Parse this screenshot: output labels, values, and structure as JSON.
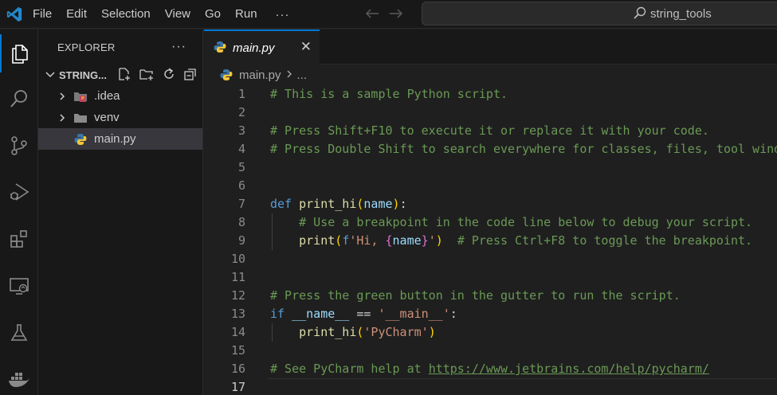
{
  "menu": {
    "items": [
      "File",
      "Edit",
      "Selection",
      "View",
      "Go",
      "Run"
    ],
    "more": "···"
  },
  "search": {
    "text": "string_tools"
  },
  "explorer": {
    "title": "EXPLORER",
    "more": "···",
    "folder": "STRING...",
    "items": [
      {
        "label": ".idea",
        "type": "folder",
        "icon": "idea-folder-icon"
      },
      {
        "label": "venv",
        "type": "folder",
        "icon": "folder-icon"
      },
      {
        "label": "main.py",
        "type": "file",
        "icon": "python-file-icon",
        "selected": true
      }
    ]
  },
  "editor": {
    "tab_label": "main.py",
    "close": "✕",
    "breadcrumb": {
      "file": "main.py",
      "ellipsis": "..."
    },
    "current_line": 17,
    "line_numbers": [
      "1",
      "2",
      "3",
      "4",
      "5",
      "6",
      "7",
      "8",
      "9",
      "10",
      "11",
      "12",
      "13",
      "14",
      "15",
      "16",
      "17"
    ],
    "lines": [
      [
        {
          "t": "# This is a sample Python script.",
          "c": "cm"
        }
      ],
      [],
      [
        {
          "t": "# Press Shift+F10 to execute it or replace it with your code.",
          "c": "cm"
        }
      ],
      [
        {
          "t": "# Press Double Shift to search everywhere for classes, files, tool windows, actions, and settings.",
          "c": "cm"
        }
      ],
      [],
      [],
      [
        {
          "t": "def ",
          "c": "kw"
        },
        {
          "t": "print_hi",
          "c": "fn"
        },
        {
          "t": "(",
          "c": "br"
        },
        {
          "t": "name",
          "c": "pm"
        },
        {
          "t": ")",
          "c": "br"
        },
        {
          "t": ":",
          "c": "tx"
        }
      ],
      [
        {
          "t": "    ",
          "c": "tx"
        },
        {
          "t": "# Use a breakpoint in the code line below to debug your script.",
          "c": "cm"
        }
      ],
      [
        {
          "t": "    ",
          "c": "tx"
        },
        {
          "t": "print",
          "c": "fn"
        },
        {
          "t": "(",
          "c": "br"
        },
        {
          "t": "f",
          "c": "kw"
        },
        {
          "t": "'Hi, ",
          "c": "st"
        },
        {
          "t": "{",
          "c": "br2"
        },
        {
          "t": "name",
          "c": "pm"
        },
        {
          "t": "}",
          "c": "br2"
        },
        {
          "t": "'",
          "c": "st"
        },
        {
          "t": ")",
          "c": "br"
        },
        {
          "t": "  ",
          "c": "tx"
        },
        {
          "t": "# Press Ctrl+F8 to toggle the breakpoint.",
          "c": "cm"
        }
      ],
      [],
      [],
      [
        {
          "t": "# Press the green button in the gutter to run the script.",
          "c": "cm"
        }
      ],
      [
        {
          "t": "if ",
          "c": "kw"
        },
        {
          "t": "__name__",
          "c": "pm"
        },
        {
          "t": " == ",
          "c": "tx"
        },
        {
          "t": "'__main__'",
          "c": "st"
        },
        {
          "t": ":",
          "c": "tx"
        }
      ],
      [
        {
          "t": "    ",
          "c": "tx"
        },
        {
          "t": "print_hi",
          "c": "fn"
        },
        {
          "t": "(",
          "c": "br"
        },
        {
          "t": "'PyCharm'",
          "c": "st"
        },
        {
          "t": ")",
          "c": "br"
        }
      ],
      [],
      [
        {
          "t": "# See PyCharm help at ",
          "c": "cm"
        },
        {
          "t": "https://www.jetbrains.com/help/pycharm/",
          "c": "lk"
        }
      ],
      []
    ]
  },
  "colors": {
    "accent": "#0078d4",
    "comment": "#6a9955",
    "keyword": "#569cd6",
    "function": "#dcdcaa",
    "string": "#ce9178"
  }
}
